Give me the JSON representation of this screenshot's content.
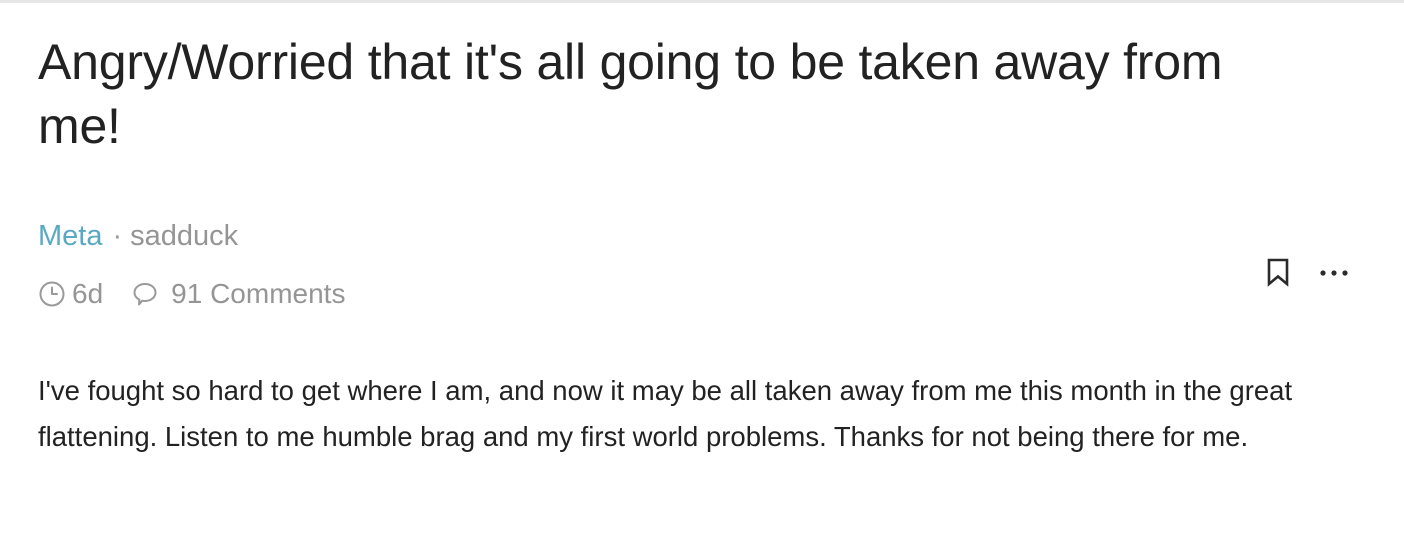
{
  "post": {
    "title": "Angry/Worried that it's all going to be taken away from me!",
    "category": "Meta",
    "separator": "·",
    "author": "sadduck",
    "age": "6d",
    "comments": "91 Comments",
    "body": "I've fought so hard to get where I am, and now it may be all taken away from me this month in the great flattening. Listen to me humble brag and my first world problems. Thanks for not being there for me."
  },
  "icons": {
    "clock": "clock-icon",
    "comment": "comment-bubble-icon",
    "bookmark": "bookmark-icon",
    "more": "more-horizontal-icon"
  },
  "colors": {
    "category_link": "#5aa9c4",
    "muted_text": "#959595",
    "body_text": "#222222"
  }
}
